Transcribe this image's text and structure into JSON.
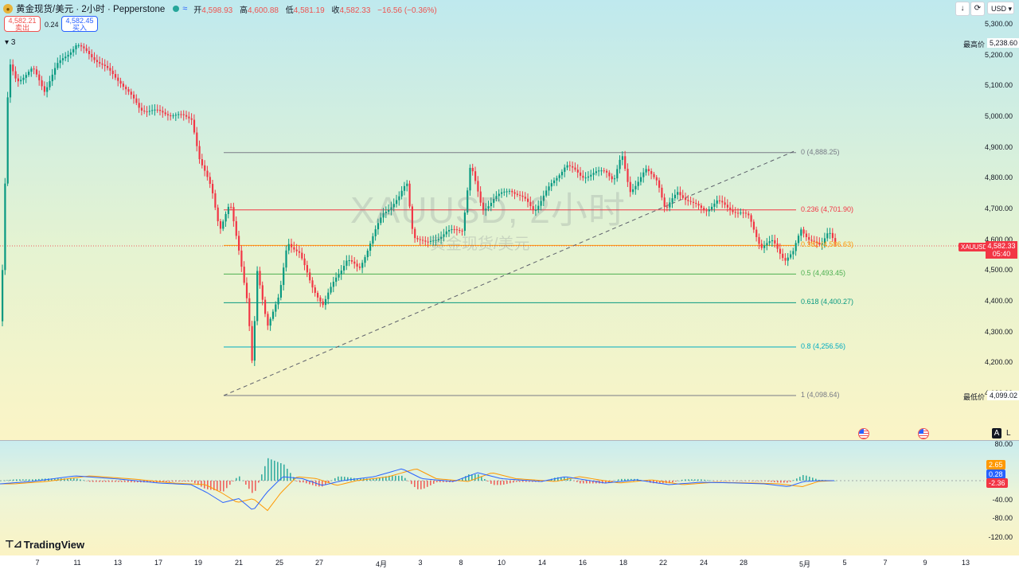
{
  "header": {
    "symbol_title": "黄金现货/美元 · 2小时 · Pepperstone",
    "open_label": "开",
    "open": "4,598.93",
    "high_label": "高",
    "high": "4,600.88",
    "low_label": "低",
    "low": "4,581.19",
    "close_label": "收",
    "close": "4,582.33",
    "change": "−16.56 (−0.36%)",
    "approx": "≈"
  },
  "quote": {
    "sell_price": "4,582.21",
    "sell_label": "卖出",
    "spread": "0.24",
    "buy_price": "4,582.45",
    "buy_label": "买入"
  },
  "indicator_count": "3",
  "currency": "USD",
  "watermark": {
    "line1": "XAUUSD, 2小时",
    "line2": "黄金现货/美元"
  },
  "price_axis": [
    "5,300.00",
    "5,200.00",
    "5,100.00",
    "5,000.00",
    "4,900.00",
    "4,800.00",
    "4,700.00",
    "4,600.00",
    "4,500.00",
    "4,400.00",
    "4,300.00",
    "4,200.00",
    "4,100.00"
  ],
  "stats": {
    "high_label": "最高价",
    "high_value": "5,238.60",
    "low_label": "最低价",
    "low_value": "4,099.02"
  },
  "last_price": {
    "symbol": "XAUUSD",
    "price": "4,582.33",
    "countdown": "05:40"
  },
  "fib_levels": [
    {
      "label": "0 (4,888.25)",
      "price": 4888.25,
      "color": "#787b86"
    },
    {
      "label": "0.236 (4,701.90)",
      "price": 4701.9,
      "color": "#f23645"
    },
    {
      "label": "0.382 (4,586.63)",
      "price": 4586.63,
      "color": "#ff9800"
    },
    {
      "label": "0.5 (4,493.45)",
      "price": 4493.45,
      "color": "#4caf50"
    },
    {
      "label": "0.618 (4,400.27)",
      "price": 4400.27,
      "color": "#089981"
    },
    {
      "label": "0.8 (4,256.56)",
      "price": 4256.56,
      "color": "#00acc1"
    },
    {
      "label": "1 (4,098.64)",
      "price": 4098.64,
      "color": "#787b86"
    }
  ],
  "macd_axis": [
    "80.00",
    "-40.00",
    "-80.00",
    "-120.00"
  ],
  "macd_tags": [
    {
      "label": "2.65",
      "color": "#ff9800"
    },
    {
      "label": "0.28",
      "color": "#2962ff"
    },
    {
      "label": "-2.36",
      "color": "#f23645"
    }
  ],
  "dates": [
    "7",
    "11",
    "13",
    "17",
    "19",
    "21",
    "25",
    "27",
    "4月",
    "3",
    "8",
    "10",
    "14",
    "16",
    "18",
    "22",
    "24",
    "28",
    "5月",
    "5",
    "7",
    "9",
    "13"
  ],
  "logo_text": "TradingView",
  "scale_buttons": {
    "auto": "A",
    "log": "L"
  },
  "colors": {
    "up": "#089981",
    "down": "#f23645",
    "macd_line": "#2962ff",
    "signal_line": "#ff9800"
  }
}
